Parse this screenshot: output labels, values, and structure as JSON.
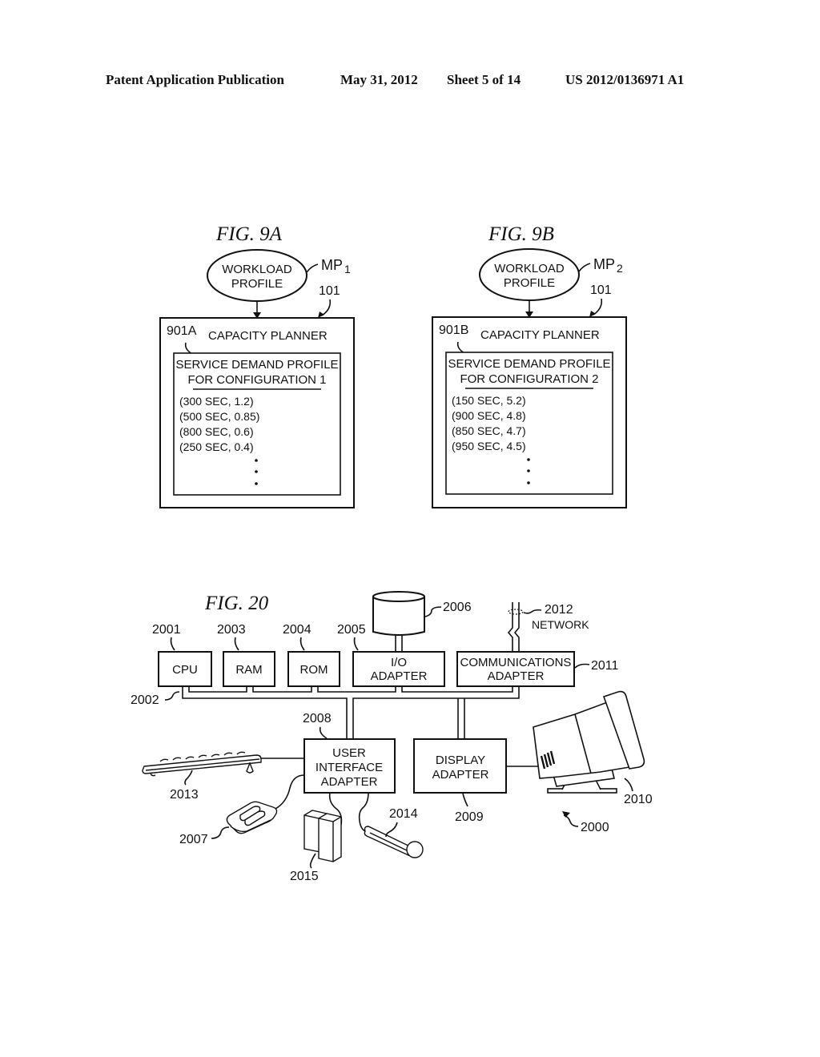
{
  "header": {
    "publication": "Patent Application Publication",
    "date": "May 31, 2012",
    "sheet": "Sheet 5 of 14",
    "number": "US 2012/0136971 A1"
  },
  "fig9a": {
    "title": "FIG. 9A",
    "ellipse_line1": "WORKLOAD",
    "ellipse_line2": "PROFILE",
    "mp_label": "MP",
    "mp_sub": "1",
    "ref_101": "101",
    "ref_901": "901A",
    "planner_label": "CAPACITY PLANNER",
    "profile_title_1": "SERVICE DEMAND PROFILE",
    "profile_title_2": "FOR CONFIGURATION 1",
    "rows": [
      "(300 SEC, 1.2)",
      "(500 SEC, 0.85)",
      "(800 SEC, 0.6)",
      "(250 SEC, 0.4)"
    ]
  },
  "fig9b": {
    "title": "FIG. 9B",
    "ellipse_line1": "WORKLOAD",
    "ellipse_line2": "PROFILE",
    "mp_label": "MP",
    "mp_sub": "2",
    "ref_101": "101",
    "ref_901": "901B",
    "planner_label": "CAPACITY PLANNER",
    "profile_title_1": "SERVICE DEMAND PROFILE",
    "profile_title_2": "FOR CONFIGURATION 2",
    "rows": [
      "(150 SEC, 5.2)",
      "(900 SEC, 4.8)",
      "(850 SEC, 4.7)",
      "(950 SEC, 4.5)"
    ]
  },
  "fig20": {
    "title": "FIG. 20",
    "cpu": {
      "label": "CPU",
      "ref": "2001"
    },
    "bus": {
      "ref": "2002"
    },
    "ram": {
      "label": "RAM",
      "ref": "2003"
    },
    "rom": {
      "label": "ROM",
      "ref": "2004"
    },
    "io": {
      "line1": "I/O",
      "line2": "ADAPTER",
      "ref": "2005"
    },
    "disk": {
      "ref": "2006"
    },
    "mouse": {
      "ref": "2007"
    },
    "ui": {
      "line1": "USER",
      "line2": "INTERFACE",
      "line3": "ADAPTER",
      "ref": "2008"
    },
    "display_adapter": {
      "line1": "DISPLAY",
      "line2": "ADAPTER",
      "ref": "2009"
    },
    "monitor": {
      "ref": "2010"
    },
    "comm": {
      "line1": "COMMUNICATIONS",
      "line2": "ADAPTER",
      "ref": "2011"
    },
    "network": {
      "label": "NETWORK",
      "ref": "2012"
    },
    "keyboard": {
      "ref": "2013"
    },
    "microphone": {
      "ref": "2014"
    },
    "speakers": {
      "ref": "2015"
    },
    "system": {
      "ref": "2000"
    }
  }
}
